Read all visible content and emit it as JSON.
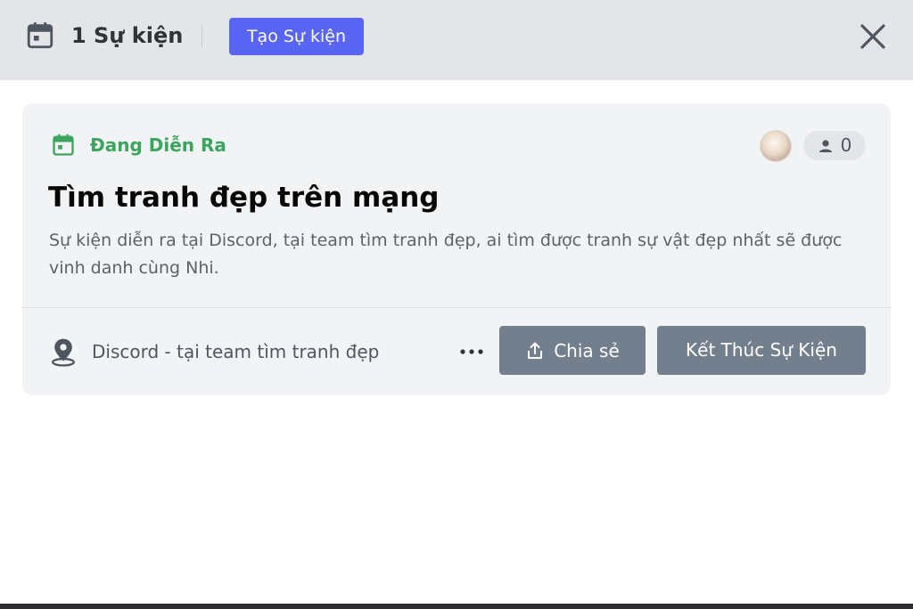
{
  "header": {
    "event_count_label": "1 Sự kiện",
    "create_button_label": "Tạo Sự kiện",
    "calendar_icon": "calendar-icon",
    "close_icon": "close-icon"
  },
  "event": {
    "status": "Đang Diễn Ra",
    "status_color": "#3ba55d",
    "attendee_count": "0",
    "title": "Tìm tranh đẹp trên mạng",
    "description": "Sự kiện diễn ra tại Discord, tại team tìm tranh đẹp, ai tìm được tranh sự vật đẹp nhất sẽ được vinh danh cùng Nhi.",
    "location": "Discord - tại team tìm tranh đẹp",
    "share_button_label": "Chia sẻ",
    "end_button_label": "Kết Thúc Sự Kiện"
  },
  "colors": {
    "accent": "#5865f2",
    "button_gray": "#747f8d",
    "header_bg": "#e3e5e8",
    "card_bg": "#f2f3f5"
  }
}
